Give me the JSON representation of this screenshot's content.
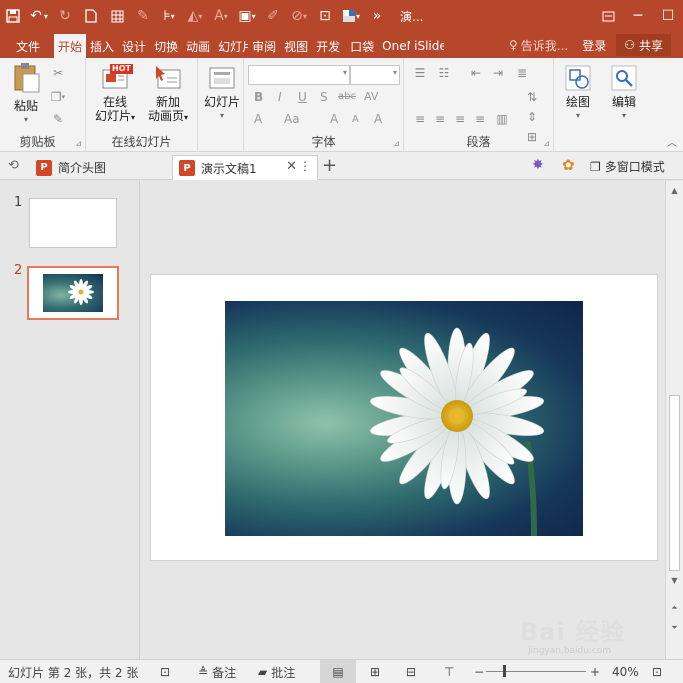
{
  "titlebar": {
    "title": "演...",
    "icons": [
      "save-icon",
      "undo-icon",
      "redo-icon",
      "new-file-icon",
      "table-icon",
      "eyedropper-icon",
      "align-icon",
      "fill-icon",
      "font-color-icon",
      "clipboard-icon",
      "brush-icon",
      "shape-icon",
      "frame-icon",
      "theme-icon",
      "more-icon"
    ]
  },
  "tabs": [
    {
      "label": "文件"
    },
    {
      "label": "开始"
    },
    {
      "label": "插入"
    },
    {
      "label": "设计"
    },
    {
      "label": "切换"
    },
    {
      "label": "动画"
    },
    {
      "label": "幻灯片"
    },
    {
      "label": "审阅"
    },
    {
      "label": "视图"
    },
    {
      "label": "开发"
    },
    {
      "label": "口袋"
    },
    {
      "label": "OneN"
    },
    {
      "label": "iSlide"
    }
  ],
  "tell_me": "告诉我...",
  "login": "登录",
  "share": "共享",
  "ribbon": {
    "paste": "粘贴",
    "clipboard_group": "剪贴板",
    "online_slides_1": "在线",
    "online_slides_2": "幻灯片",
    "hot_badge": "HOT",
    "new_anim_1": "新加",
    "new_anim_2": "动画页",
    "online_group": "在线幻灯片",
    "slides_btn": "幻灯片",
    "font_group": "字体",
    "para_group": "段落",
    "draw_btn": "绘图",
    "edit_btn": "编辑",
    "bold": "B",
    "italic": "I",
    "underline": "U",
    "shadow": "S",
    "strike": "abc",
    "spacing": "AV",
    "font_color": "A",
    "case": "Aa",
    "grow": "A",
    "shrink": "A",
    "clear": "A"
  },
  "doctabs": {
    "tab1": "简介头图",
    "tab2": "演示文稿1",
    "multiwindow": "多窗口模式"
  },
  "thumbnails": [
    {
      "number": "1"
    },
    {
      "number": "2"
    }
  ],
  "status": {
    "slide_info": "幻灯片 第 2 张，共 2 张",
    "notes": "备注",
    "comments": "批注",
    "zoom": "40%",
    "zoom_level": 0.4
  },
  "watermark": "Bai 经验",
  "watermark_sub": "jingyan.baidu.com"
}
